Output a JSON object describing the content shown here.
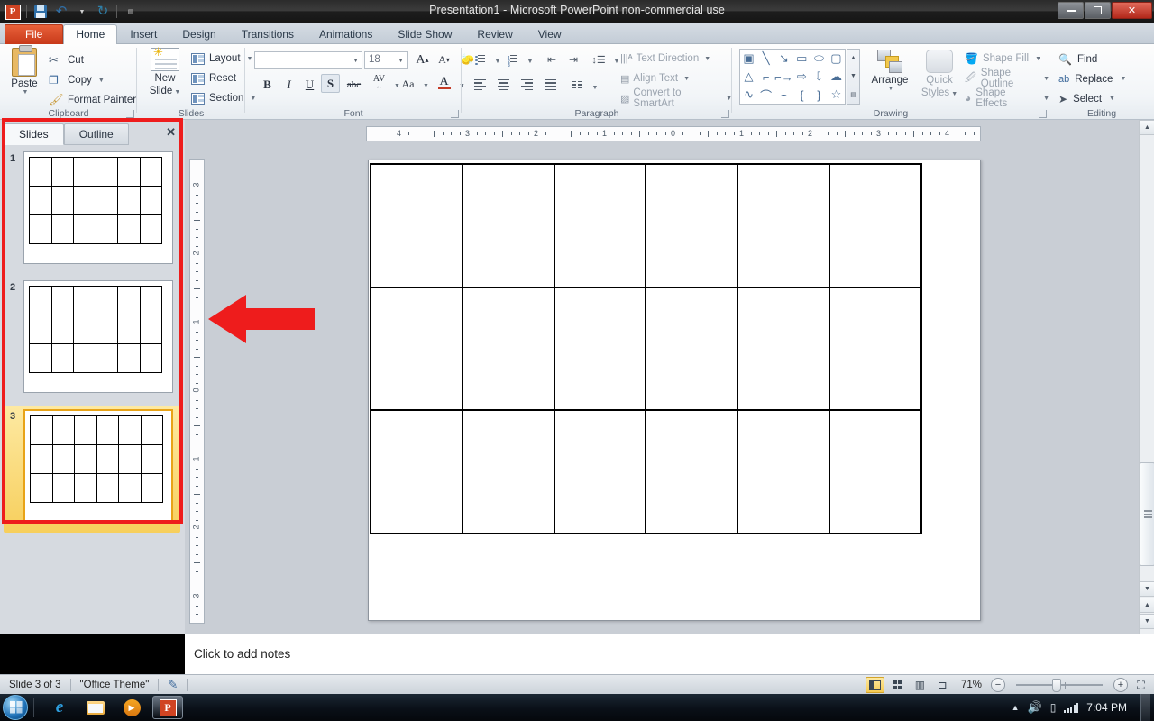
{
  "window": {
    "title": "Presentation1  -  Microsoft PowerPoint non-commercial use",
    "app_logo": "P",
    "minimize": "minimize-icon",
    "maximize": "restore-icon",
    "close": "✕"
  },
  "quick_access": [
    {
      "name": "save-icon",
      "label": "Save"
    },
    {
      "name": "undo-icon",
      "label": "↶"
    },
    {
      "name": "undo-dropdown-icon",
      "label": "▾"
    },
    {
      "name": "redo-icon",
      "label": "↻"
    },
    {
      "name": "customize-qat-icon",
      "label": "▾"
    }
  ],
  "ribbon": {
    "tabs": [
      {
        "label": "File",
        "active": false
      },
      {
        "label": "Home",
        "active": true
      },
      {
        "label": "Insert",
        "active": false
      },
      {
        "label": "Design",
        "active": false
      },
      {
        "label": "Transitions",
        "active": false
      },
      {
        "label": "Animations",
        "active": false
      },
      {
        "label": "Slide Show",
        "active": false
      },
      {
        "label": "Review",
        "active": false
      },
      {
        "label": "View",
        "active": false
      }
    ],
    "groups": {
      "clipboard": {
        "label": "Clipboard",
        "paste": "Paste",
        "cut": "Cut",
        "copy": "Copy",
        "format_painter": "Format Painter"
      },
      "slides": {
        "label": "Slides",
        "new_slide": "New\nSlide",
        "new_slide_line1": "New",
        "new_slide_line2": "Slide",
        "layout": "Layout",
        "reset": "Reset",
        "section": "Section"
      },
      "font": {
        "label": "Font",
        "font_name_value": "",
        "font_name_placeholder": "",
        "font_size_value": "18",
        "grow_font": "A",
        "shrink_font": "A",
        "clear_formatting": "Aa",
        "bold": "B",
        "italic": "I",
        "underline": "U",
        "shadow": "S",
        "strikethrough": "abc",
        "character_spacing": "AV",
        "change_case": "Aa",
        "font_color": "A"
      },
      "paragraph": {
        "label": "Paragraph",
        "text_direction": "Text Direction",
        "align_text": "Align Text",
        "convert_to_smartart": "Convert to SmartArt"
      },
      "drawing": {
        "label": "Drawing",
        "arrange": "Arrange",
        "quick_styles_line1": "Quick",
        "quick_styles_line2": "Styles",
        "shape_fill": "Shape Fill",
        "shape_outline": "Shape Outline",
        "shape_effects": "Shape Effects",
        "shapes": [
          "textbox",
          "line",
          "arrow",
          "rectangle",
          "oval",
          "rounded-rectangle",
          "triangle",
          "elbow-connector",
          "elbow-arrow-connector",
          "right-arrow",
          "down-arrow",
          "cloud",
          "scribble",
          "curve",
          "arc",
          "left-brace",
          "right-brace",
          "star"
        ]
      },
      "editing": {
        "label": "Editing",
        "find": "Find",
        "replace": "Replace",
        "select": "Select"
      }
    }
  },
  "slide_pane": {
    "tabs": [
      {
        "label": "Slides",
        "active": true
      },
      {
        "label": "Outline",
        "active": false
      }
    ],
    "close_label": "✕",
    "thumbnails": [
      {
        "number": "1",
        "selected": false
      },
      {
        "number": "2",
        "selected": false
      },
      {
        "number": "3",
        "selected": true
      }
    ]
  },
  "rulers": {
    "horizontal_labels": [
      "4",
      "3",
      "2",
      "1",
      "0",
      "1",
      "2",
      "3",
      "4"
    ],
    "vertical_labels": [
      "3",
      "2",
      "1",
      "0",
      "1",
      "2",
      "3"
    ]
  },
  "slide_canvas": {
    "table": {
      "columns": 6,
      "rows": 3
    },
    "annotation_arrow": {
      "name": "red-left-arrow",
      "color": "#ee1c1c",
      "direction": "left"
    },
    "annotation_rect_color": "#ee1c1c"
  },
  "notes": {
    "placeholder": "Click to add notes"
  },
  "status_bar": {
    "slide_indicator": "Slide 3 of 3",
    "theme": "\"Office Theme\"",
    "spellcheck_icon": "spellcheck-icon",
    "views": [
      {
        "name": "normal-view",
        "active": true
      },
      {
        "name": "slide-sorter-view",
        "active": false
      },
      {
        "name": "reading-view",
        "active": false
      },
      {
        "name": "slide-show-view",
        "active": false
      }
    ],
    "zoom_value": "71%",
    "zoom_out": "−",
    "zoom_in": "+",
    "fit_to_window": "fit-slide-icon"
  },
  "taskbar": {
    "start": "start-orb",
    "items": [
      {
        "name": "internet-explorer-icon",
        "active": false
      },
      {
        "name": "windows-explorer-icon",
        "active": false
      },
      {
        "name": "media-player-icon",
        "active": false
      },
      {
        "name": "powerpoint-taskbar-icon",
        "active": true
      }
    ],
    "tray": {
      "show_hidden": "▲",
      "volume": "volume-icon",
      "battery": "battery-icon",
      "network": "network-signal-icon",
      "time": "7:04 PM"
    }
  }
}
